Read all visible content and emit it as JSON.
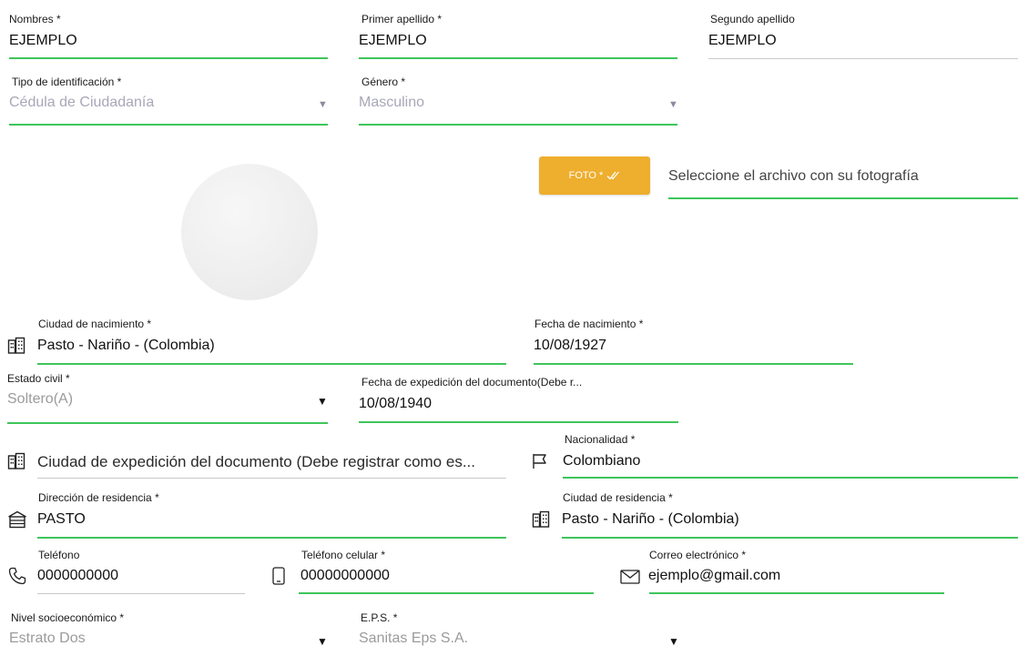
{
  "nombres": {
    "label": "Nombres *",
    "value": "EJEMPLO"
  },
  "primer_apellido": {
    "label": "Primer apellido *",
    "value": "EJEMPLO"
  },
  "segundo_apellido": {
    "label": "Segundo apellido",
    "value": "EJEMPLO"
  },
  "tipo_identificacion": {
    "label": "Tipo de identificación *",
    "value": "Cédula de Ciudadanía"
  },
  "genero": {
    "label": "Género *",
    "value": "Masculino"
  },
  "foto": {
    "button_label": "FOTO *",
    "file_placeholder": "Seleccione el archivo con su fotografía"
  },
  "ciudad_nacimiento": {
    "label": "Ciudad de nacimiento *",
    "value": "Pasto - Nariño - (Colombia)"
  },
  "fecha_nacimiento": {
    "label": "Fecha de nacimiento *",
    "value": "10/08/1927"
  },
  "estado_civil": {
    "label": "Estado civil *",
    "value": "Soltero(A)"
  },
  "fecha_expedicion": {
    "label": "Fecha de expedición del documento(Debe r...",
    "value": "10/08/1940"
  },
  "ciudad_expedicion": {
    "placeholder": "Ciudad de expedición del documento (Debe registrar como es..."
  },
  "nacionalidad": {
    "label": "Nacionalidad *",
    "value": "Colombiano"
  },
  "direccion": {
    "label": "Dirección de residencia *",
    "value": "PASTO"
  },
  "ciudad_residencia": {
    "label": "Ciudad de residencia *",
    "value": "Pasto - Nariño - (Colombia)"
  },
  "telefono": {
    "label": "Teléfono",
    "value": "0000000000"
  },
  "celular": {
    "label": "Teléfono celular *",
    "value": "00000000000"
  },
  "correo": {
    "label": "Correo electrónico *",
    "value": "ejemplo@gmail.com"
  },
  "nivel_socioeconomico": {
    "label": "Nivel socioeconómico *",
    "value": "Estrato Dos"
  },
  "eps": {
    "label": "E.P.S. *",
    "value": "Sanitas Eps S.A."
  },
  "icons": [
    "building-icon",
    "check-double-icon",
    "flag-icon",
    "home-icon",
    "phone-icon",
    "mobile-icon",
    "mail-icon",
    "dropdown-arrow-icon"
  ],
  "colors": {
    "accent_line": "#3ec55b",
    "button": "#eeae2e",
    "placeholder": "#a7a7b8"
  }
}
